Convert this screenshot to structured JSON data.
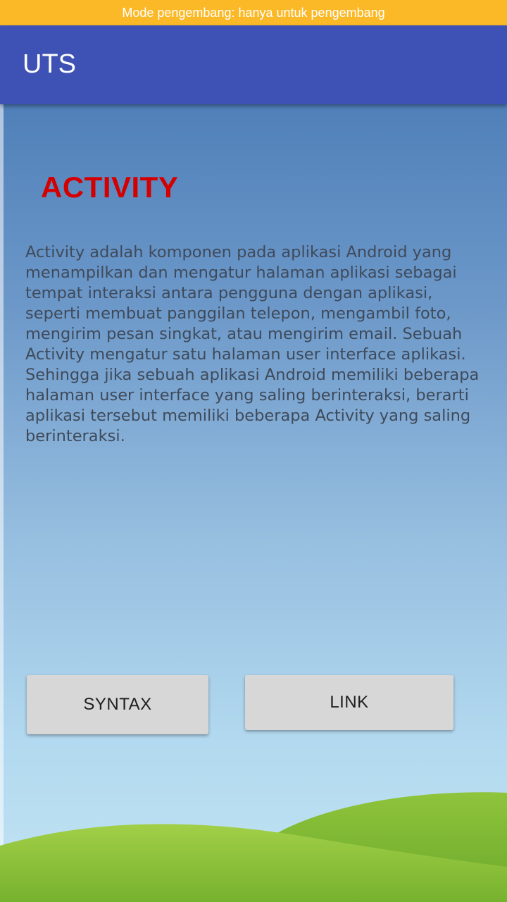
{
  "status_banner": {
    "text": "Mode pengembang: hanya untuk pengembang",
    "color": "#fbb927"
  },
  "app_bar": {
    "title": "UTS",
    "color": "#3e51b5"
  },
  "main": {
    "heading": "ACTIVITY",
    "heading_color": "#d40000",
    "description": "Activity adalah komponen pada aplikasi Android yang menampilkan dan mengatur halaman aplikasi sebagai tempat interaksi antara pengguna dengan aplikasi, seperti membuat panggilan telepon, mengambil foto, mengirim pesan singkat, atau mengirim email. Sebuah Activity mengatur satu halaman user interface aplikasi. Sehingga jika sebuah aplikasi Android memiliki beberapa halaman user interface yang saling berinteraksi, berarti aplikasi tersebut memiliki beberapa Activity yang saling berinteraksi."
  },
  "buttons": {
    "syntax_label": "SYNTAX",
    "link_label": "LINK"
  },
  "background": {
    "sky_top": "#5080b9",
    "sky_bottom": "#c2e4f3",
    "grass": "#7ab32e"
  }
}
